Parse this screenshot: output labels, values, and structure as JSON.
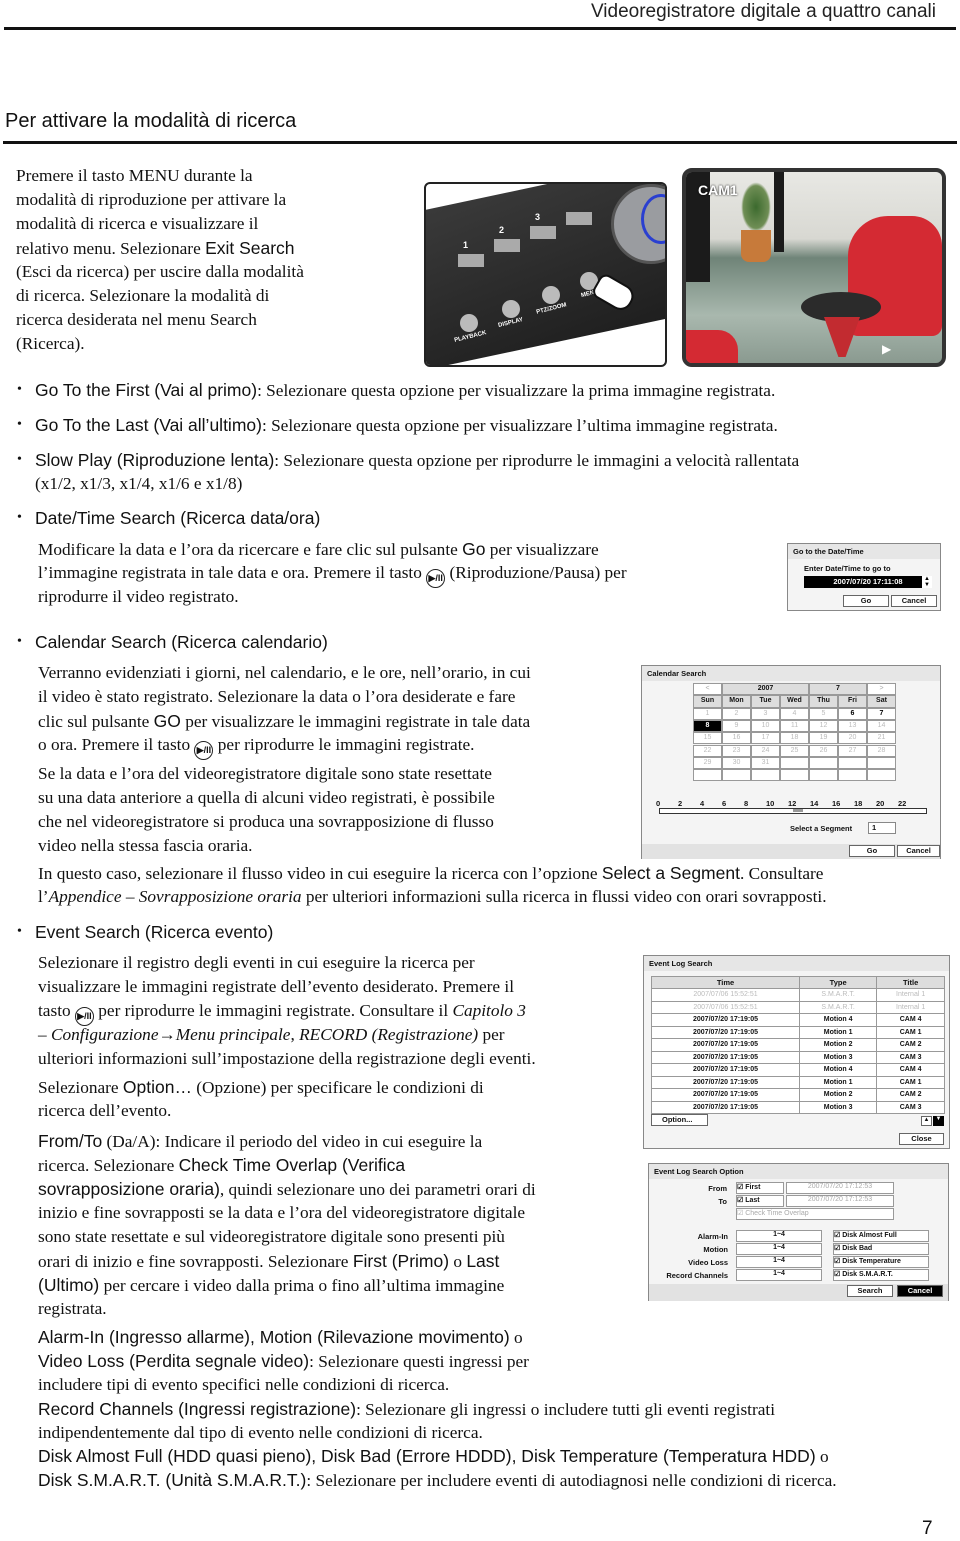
{
  "header": {
    "running_title": "Videoregistratore digitale a quattro canali",
    "section_title": "Per attivare la modalità di ricerca",
    "page_number": "7"
  },
  "images": {
    "dvr_panel": {
      "buttons": [
        "1",
        "2",
        "3"
      ],
      "labels": [
        "PLAYBACK",
        "DISPLAY",
        "PTZ/ZOOM",
        "MENU"
      ]
    },
    "camera": {
      "label": "CAM1"
    }
  },
  "text": {
    "intro": [
      [
        [
          "r",
          "Premere il tasto MENU durante la"
        ]
      ],
      [
        [
          "r",
          "modalità di riproduzione per attivare la"
        ]
      ],
      [
        [
          "r",
          "modalità di ricerca e visualizzare il"
        ]
      ],
      [
        [
          "r",
          "relativo menu. Selezionare "
        ],
        [
          "s",
          "Exit Search"
        ]
      ],
      [
        [
          "r",
          "(Esci da ricerca) per uscire dalla modalità"
        ]
      ],
      [
        [
          "r",
          "di ricerca. Selezionare la modalità di"
        ]
      ],
      [
        [
          "r",
          "ricerca desiderata nel menu Search"
        ]
      ],
      [
        [
          "r",
          "(Ricerca)."
        ]
      ]
    ],
    "b1": [
      [
        [
          "s",
          "Go To the First (Vai al primo)"
        ],
        [
          "r",
          ": Selezionare questa opzione per visualizzare la prima immagine registrata."
        ]
      ]
    ],
    "b2": [
      [
        [
          "s",
          "Go To the Last (Vai all’ultimo)"
        ],
        [
          "r",
          ": Selezionare questa opzione per visualizzare l’ultima immagine registrata."
        ]
      ]
    ],
    "b3": [
      [
        [
          "s",
          "Slow Play (Riproduzione lenta)"
        ],
        [
          "r",
          ": Selezionare questa opzione per riprodurre le immagini a velocità rallentata"
        ]
      ],
      [
        [
          "r",
          "(x1/2, x1/3, x1/4, x1/6 e x1/8)"
        ]
      ]
    ],
    "b4": [
      [
        [
          "s",
          "Date/Time Search (Ricerca data/ora)"
        ]
      ]
    ],
    "b4t": [
      [
        [
          "r",
          "Modificare la data e l’ora da ricercare e fare clic sul pulsante "
        ],
        [
          "s",
          "Go"
        ],
        [
          "r",
          " per visualizzare"
        ]
      ],
      [
        [
          "r",
          "l’immagine registrata in tale data e ora. Premere il tasto "
        ],
        [
          "icon",
          "▶/II"
        ],
        [
          "r",
          " (Riproduzione/Pausa) per"
        ]
      ],
      [
        [
          "r",
          "riprodurre il video registrato."
        ]
      ]
    ],
    "b5": [
      [
        [
          "s",
          "Calendar Search (Ricerca calendario)"
        ]
      ]
    ],
    "b5t": [
      [
        [
          "r",
          "Verranno evidenziati i giorni, nel calendario, e le ore, nell’orario, in cui"
        ]
      ],
      [
        [
          "r",
          "il video è stato registrato. Selezionare la data o l’ora desiderate e fare"
        ]
      ],
      [
        [
          "r",
          "clic sul pulsante "
        ],
        [
          "s",
          "GO"
        ],
        [
          "r",
          " per visualizzare le immagini registrate in tale data"
        ]
      ],
      [
        [
          "r",
          "o ora. Premere il tasto "
        ],
        [
          "icon",
          "▶/II"
        ],
        [
          "r",
          " per riprodurre le immagini registrate."
        ]
      ]
    ],
    "b5t2": [
      [
        [
          "r",
          "Se la data e l’ora del videoregistratore digitale sono state resettate"
        ]
      ],
      [
        [
          "r",
          "su una data anteriore a quella di alcuni video registrati, è possibile"
        ]
      ],
      [
        [
          "r",
          "che nel videoregistratore si produca una sovrapposizione di flusso"
        ]
      ],
      [
        [
          "r",
          "video nella stessa fascia oraria."
        ]
      ]
    ],
    "b5t3": [
      [
        [
          "r",
          "In questo caso, selezionare il flusso video in cui eseguire la ricerca con l’opzione "
        ],
        [
          "s",
          "Select a Segment"
        ],
        [
          "r",
          ". Consultare"
        ]
      ],
      [
        [
          "r",
          "l’"
        ],
        [
          "i",
          "Appendice – Sovrapposizione oraria"
        ],
        [
          "r",
          " per ulteriori informazioni sulla ricerca in flussi video con orari sovrapposti."
        ]
      ]
    ],
    "b6": [
      [
        [
          "s",
          "Event Search (Ricerca evento)"
        ]
      ]
    ],
    "b6t": [
      [
        [
          "r",
          "Selezionare il registro degli eventi in cui eseguire la ricerca per"
        ]
      ],
      [
        [
          "r",
          "visualizzare le immagini registrate dell’evento desiderato. Premere il"
        ]
      ],
      [
        [
          "r",
          "tasto "
        ],
        [
          "icon",
          "▶/II"
        ],
        [
          "r",
          " per riprodurre le immagini registrate. Consultare il "
        ],
        [
          "i",
          "Capitolo 3"
        ]
      ],
      [
        [
          "i",
          "– Configurazione"
        ],
        [
          "r",
          "→"
        ],
        [
          "i",
          "Menu principale"
        ],
        [
          "r",
          ", "
        ],
        [
          "i",
          "RECORD (Registrazione)"
        ],
        [
          "r",
          " per"
        ]
      ],
      [
        [
          "r",
          "ulteriori informazioni sull’impostazione della registrazione degli eventi."
        ]
      ]
    ],
    "b6t2": [
      [
        [
          "r",
          "Selezionare "
        ],
        [
          "s",
          "Option…"
        ],
        [
          "r",
          " (Opzione) per specificare le condizioni di"
        ]
      ],
      [
        [
          "r",
          "ricerca dell’evento."
        ]
      ]
    ],
    "b6t3": [
      [
        [
          "s",
          "From/To"
        ],
        [
          "r",
          " (Da/A): Indicare il periodo del video in cui eseguire la"
        ]
      ],
      [
        [
          "r",
          "ricerca. Selezionare "
        ],
        [
          "s",
          "Check Time Overlap (Verifica"
        ]
      ],
      [
        [
          "s",
          "sovrapposizione oraria)"
        ],
        [
          "r",
          ", quindi selezionare uno dei parametri orari di"
        ]
      ],
      [
        [
          "r",
          "inizio e fine sovrapposti se la data e l’ora del videoregistratore digitale"
        ]
      ],
      [
        [
          "r",
          "sono state resettate e sul videoregistratore digitale sono presenti più"
        ]
      ],
      [
        [
          "r",
          "orari di inizio e fine sovrapposti. Selezionare "
        ],
        [
          "s",
          "First (Primo)"
        ],
        [
          "r",
          " o "
        ],
        [
          "s",
          "Last"
        ]
      ],
      [
        [
          "s",
          "(Ultimo)"
        ],
        [
          "r",
          " per cercare i video dalla prima o fino all’ultima immagine"
        ]
      ],
      [
        [
          "r",
          "registrata."
        ]
      ]
    ],
    "b6t4": [
      [
        [
          "s",
          "Alarm-In (Ingresso allarme), Motion (Rilevazione movimento)"
        ],
        [
          "r",
          " o"
        ]
      ],
      [
        [
          "s",
          "Video Loss (Perdita segnale video)"
        ],
        [
          "r",
          ": Selezionare questi ingressi per"
        ]
      ],
      [
        [
          "r",
          "includere tipi di evento specifici nelle condizioni di ricerca."
        ]
      ]
    ],
    "b6t5": [
      [
        [
          "s",
          "Record Channels (Ingressi registrazione)"
        ],
        [
          "r",
          ": Selezionare gli ingressi o includere tutti gli eventi registrati"
        ]
      ],
      [
        [
          "r",
          "indipendentemente dal tipo di evento nelle condizioni di ricerca."
        ]
      ]
    ],
    "b6t6": [
      [
        [
          "s",
          "Disk Almost Full (HDD quasi pieno), Disk Bad (Errore HDDD), Disk Temperature (Temperatura HDD)"
        ],
        [
          "r",
          " o"
        ]
      ],
      [
        [
          "s",
          "Disk S.M.A.R.T. (Unità S.M.A.R.T.)"
        ],
        [
          "r",
          ": Selezionare per includere eventi di autodiagnosi nelle condizioni di ricerca."
        ]
      ]
    ]
  },
  "goto_dialog": {
    "title": "Go to the Date/Time",
    "prompt": "Enter Date/Time to go to",
    "value": "2007/07/20  17:11:08",
    "go": "Go",
    "cancel": "Cancel"
  },
  "calendar_dialog": {
    "title": "Calendar Search",
    "prev": "<",
    "year": "2007",
    "month": "7",
    "next": ">",
    "weekdays": [
      "Sun",
      "Mon",
      "Tue",
      "Wed",
      "Thu",
      "Fri",
      "Sat"
    ],
    "days": 31,
    "recorded_days": [
      6,
      7
    ],
    "selected_day": 8,
    "hours": [
      "0",
      "2",
      "4",
      "6",
      "8",
      "10",
      "12",
      "14",
      "16",
      "18",
      "20",
      "22"
    ],
    "segment_label": "Select a Segment",
    "segment_value": "1",
    "go": "Go",
    "cancel": "Cancel"
  },
  "event_log_dialog": {
    "title": "Event Log Search",
    "columns": [
      "Time",
      "Type",
      "Title"
    ],
    "rows": [
      [
        "2007/07/06  15:52:51",
        "S.M.A.R.T.",
        "Internal 1",
        true
      ],
      [
        "2007/07/06  15:52:51",
        "S.M.A.R.T.",
        "Internal 1",
        true
      ],
      [
        "2007/07/20  17:19:05",
        "Motion 4",
        "CAM 4",
        false
      ],
      [
        "2007/07/20  17:19:05",
        "Motion 1",
        "CAM 1",
        false
      ],
      [
        "2007/07/20  17:19:05",
        "Motion 2",
        "CAM 2",
        false
      ],
      [
        "2007/07/20  17:19:05",
        "Motion 3",
        "CAM 3",
        false
      ],
      [
        "2007/07/20  17:19:05",
        "Motion 4",
        "CAM 4",
        false
      ],
      [
        "2007/07/20  17:19:05",
        "Motion 1",
        "CAM 1",
        false
      ],
      [
        "2007/07/20  17:19:05",
        "Motion 2",
        "CAM 2",
        false
      ],
      [
        "2007/07/20  17:19:05",
        "Motion 3",
        "CAM 3",
        false
      ]
    ],
    "option": "Option...",
    "close": "Close"
  },
  "event_option_dialog": {
    "title": "Event Log Search Option",
    "from_label": "From",
    "to_label": "To",
    "first": "First",
    "last": "Last",
    "from_value": "2007/07/20  17:12:53",
    "to_value": "2007/07/20  17:12:53",
    "overlap": "Check Time Overlap",
    "inputs": [
      [
        "Alarm-In",
        "1~4"
      ],
      [
        "Motion",
        "1~4"
      ],
      [
        "Video Loss",
        "1~4"
      ],
      [
        "Record Channels",
        "1~4"
      ]
    ],
    "disks": [
      "Disk Almost Full",
      "Disk Bad",
      "Disk Temperature",
      "Disk S.M.A.R.T."
    ],
    "search": "Search",
    "cancel": "Cancel"
  }
}
